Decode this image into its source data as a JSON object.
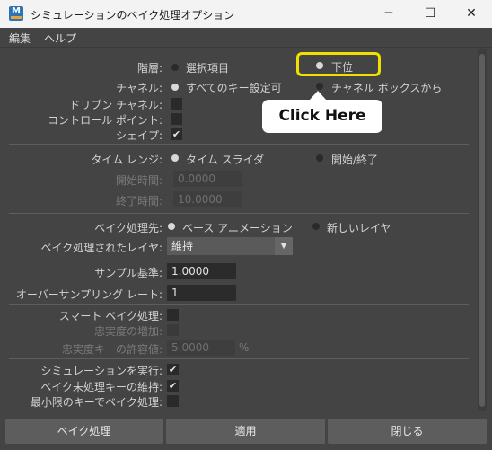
{
  "window": {
    "title": "シミュレーションのベイク処理オプション"
  },
  "titlebar": {
    "minimize_glyph": "─",
    "maximize_glyph": "☐",
    "close_glyph": "✕",
    "app_icon_letter": "M"
  },
  "menubar": {
    "items": [
      "編集",
      "ヘルプ"
    ]
  },
  "hierarchy": {
    "label": "階層:",
    "options": [
      "選択項目",
      "下位"
    ],
    "selected": "下位"
  },
  "channels": {
    "label": "チャネル:",
    "options": [
      "すべてのキー設定可",
      "チャネル ボックスから"
    ],
    "selected": "すべてのキー設定可"
  },
  "driven_channels": {
    "label": "ドリブン チャネル:",
    "checked": false
  },
  "control_points": {
    "label": "コントロール ポイント:",
    "checked": false
  },
  "shapes": {
    "label": "シェイプ:",
    "checked": true
  },
  "time_range": {
    "label": "タイム レンジ:",
    "options": [
      "タイム スライダ",
      "開始/終了"
    ],
    "selected": "タイム スライダ"
  },
  "start_time": {
    "label": "開始時間:",
    "value": "0.0000"
  },
  "end_time": {
    "label": "終了時間:",
    "value": "10.0000"
  },
  "bake_to": {
    "label": "ベイク処理先:",
    "options": [
      "ベース アニメーション",
      "新しいレイヤ"
    ],
    "selected": "ベース アニメーション"
  },
  "baked_layers": {
    "label": "ベイク処理されたレイヤ:",
    "value": "維持"
  },
  "sample_by": {
    "label": "サンプル基準:",
    "value": "1.0000"
  },
  "oversampling": {
    "label": "オーバーサンプリング レート:",
    "value": "1"
  },
  "smart_bake": {
    "label": "スマート ベイク処理:",
    "checked": false
  },
  "increase_fidelity": {
    "label": "忠実度の増加:",
    "checked": false
  },
  "fidelity_tolerance": {
    "label": "忠実度キーの許容値:",
    "value": "5.0000",
    "unit": "%"
  },
  "run_simulation": {
    "label": "シミュレーションを実行:",
    "checked": true
  },
  "keep_unbaked": {
    "label": "ベイク未処理キーの維持:",
    "checked": true
  },
  "sparse_curve": {
    "label": "最小限のキーでベイク処理:",
    "checked": false
  },
  "buttons": {
    "bake": "ベイク処理",
    "apply": "適用",
    "close": "閉じる"
  },
  "overlay": {
    "tooltip_text": "Click Here",
    "highlight_color": "#f0e000"
  }
}
